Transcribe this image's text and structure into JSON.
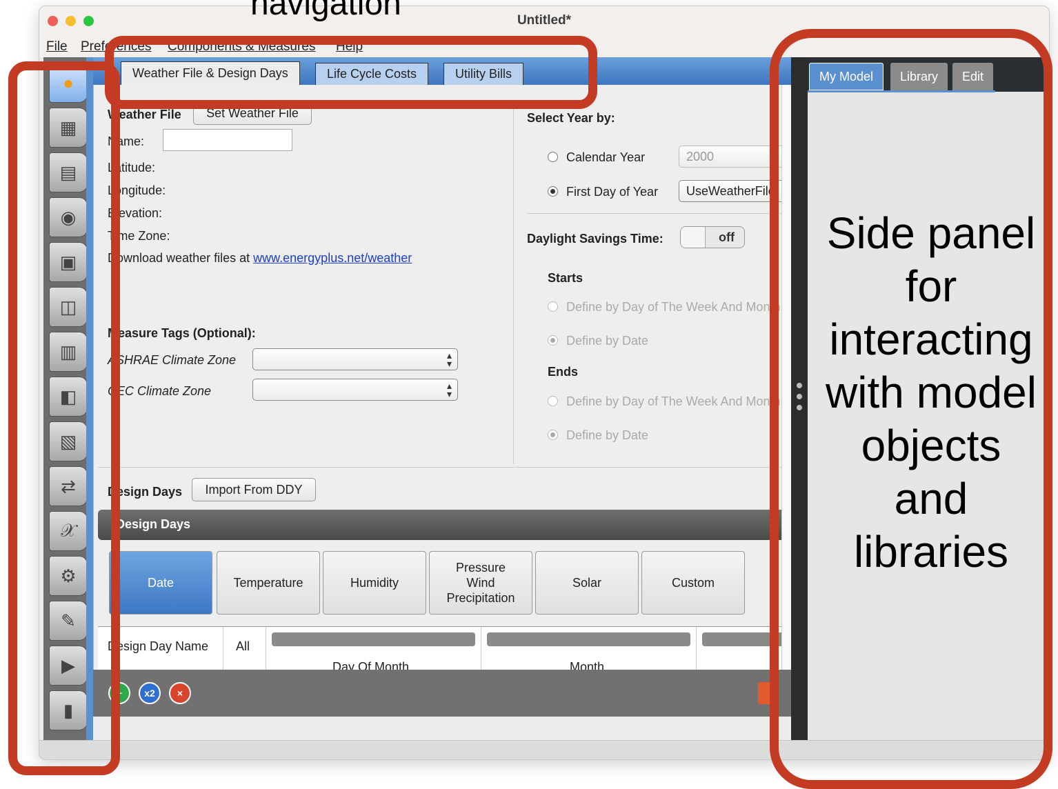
{
  "window": {
    "title": "Untitled*"
  },
  "menu": [
    "File",
    "Preferences",
    "Components & Measures",
    "Help"
  ],
  "tabs": [
    "Weather File & Design Days",
    "Life Cycle Costs",
    "Utility Bills"
  ],
  "weather": {
    "set_button": "Set Weather File",
    "name_label": "Name:",
    "name_value": "",
    "latitude_label": "Latitude:",
    "longitude_label": "Longitude:",
    "elevation_label": "Elevation:",
    "timezone_label": "Time Zone:",
    "download_text": "Download weather files at",
    "download_link": "www.energyplus.net/weather"
  },
  "measure_tags": {
    "title": "Measure Tags (Optional):",
    "ashrae_label": "ASHRAE Climate Zone",
    "cec_label": "CEC Climate Zone"
  },
  "year": {
    "title": "Select Year by:",
    "calendar_label": "Calendar Year",
    "calendar_value": "2000",
    "first_day_label": "First Day of Year",
    "first_day_value": "UseWeatherFile"
  },
  "dst": {
    "label": "Daylight Savings Time:",
    "toggle": "off",
    "starts": "Starts",
    "ends": "Ends",
    "by_week": "Define by Day of The Week And Month",
    "by_date": "Define by Date"
  },
  "design_days": {
    "label": "Design Days",
    "import_button": "Import From DDY",
    "header": "Design Days",
    "categories": [
      "Date",
      "Temperature",
      "Humidity",
      "Pressure\nWind\nPrecipitation",
      "Solar",
      "Custom"
    ],
    "columns": [
      "Design Day Name",
      "All",
      "Day Of Month",
      "Month"
    ]
  },
  "bottom_buttons": [
    "+",
    "x2",
    "×"
  ],
  "side_tabs": [
    "My Model",
    "Library",
    "Edit"
  ],
  "annotations": {
    "navigation": "navigation",
    "side_panel": "Side panel for interacting with model objects and libraries"
  },
  "colors": {
    "accent": "#c23b22",
    "tab_blue": "#5a8fd0"
  },
  "icons": [
    "site-icon",
    "schedules-icon",
    "constructions-icon",
    "loads-icon",
    "space-types-icon",
    "geometry-icon",
    "facility-icon",
    "spaces-icon",
    "thermal-zones-icon",
    "hvac-icon",
    "variables-icon",
    "simulation-settings-icon",
    "scripts-icon",
    "run-icon",
    "results-icon"
  ]
}
